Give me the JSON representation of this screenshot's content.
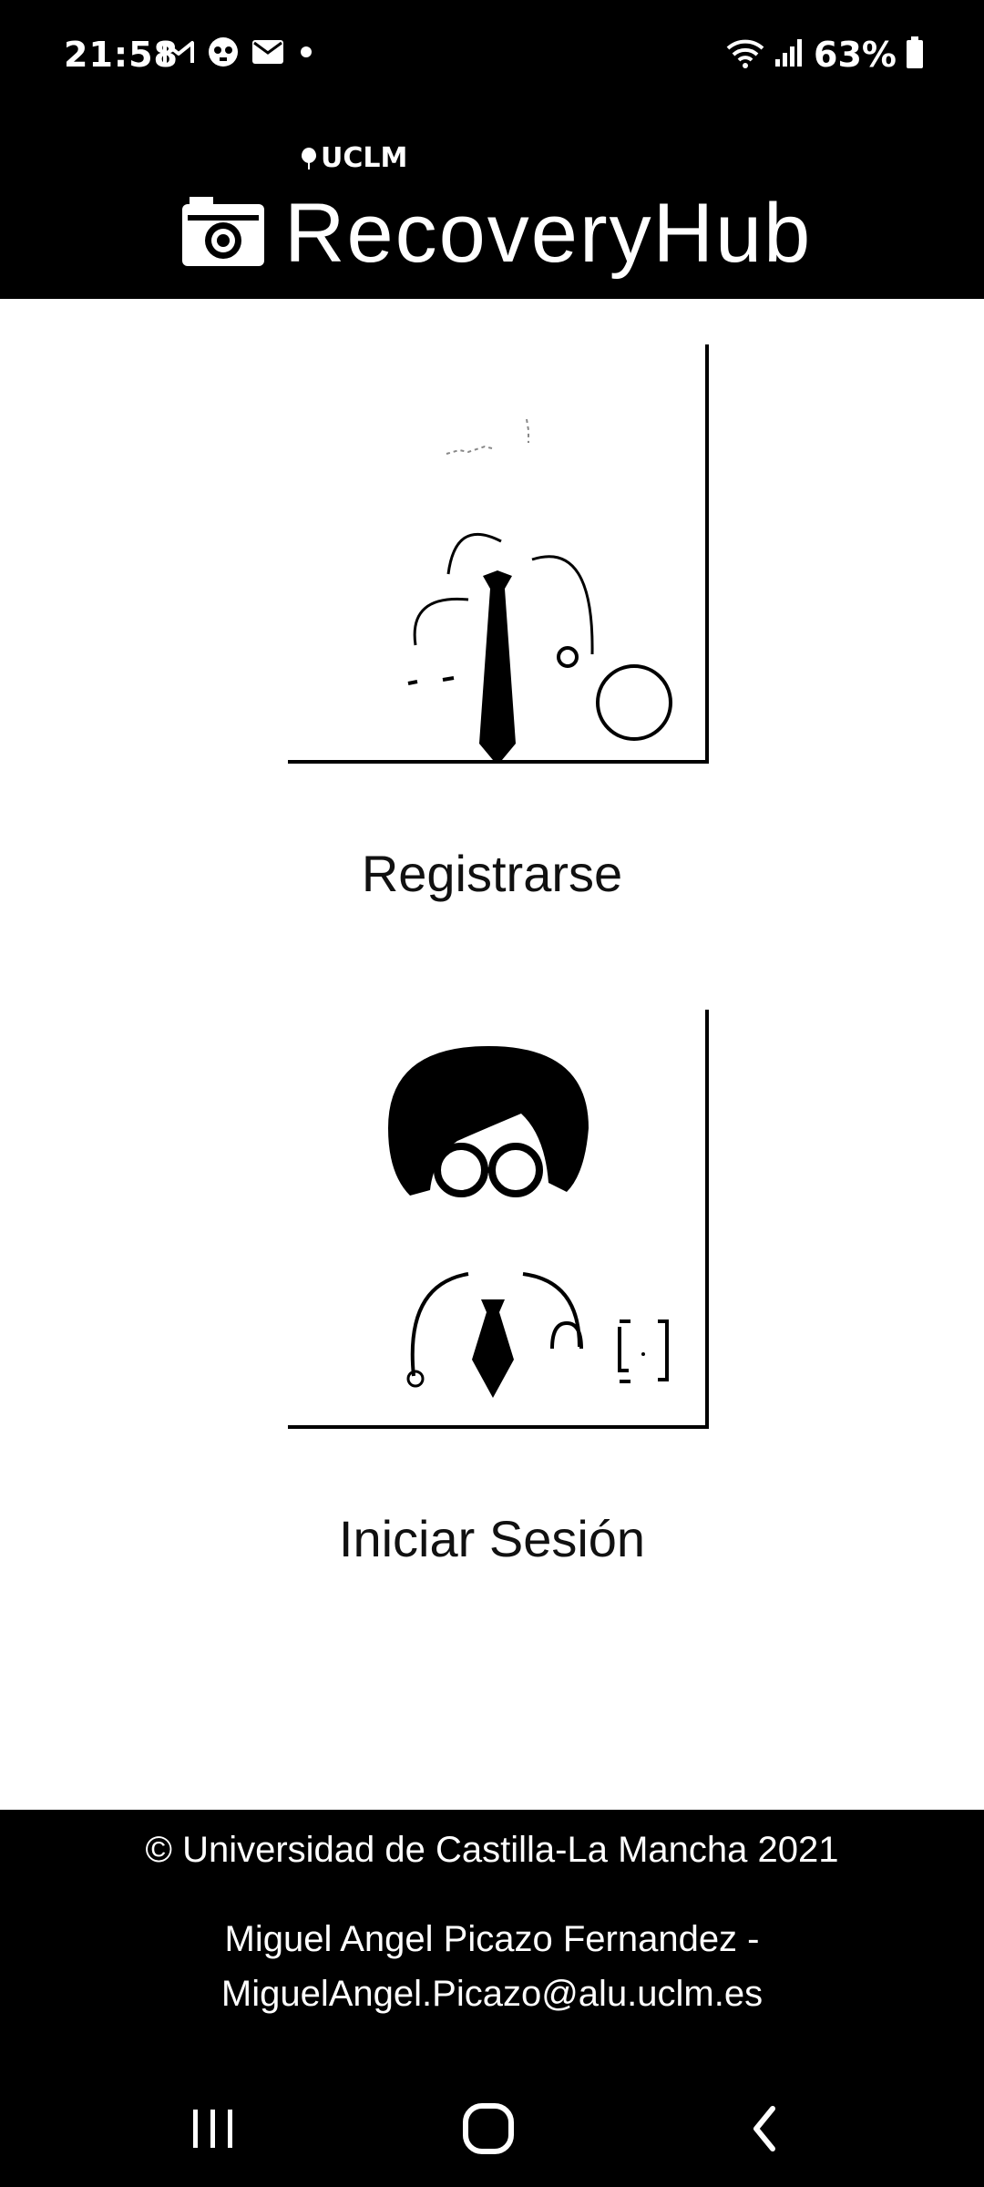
{
  "status_bar": {
    "time": "21:58",
    "left_icons": [
      "gmail-icon",
      "skull-icon",
      "mail-icon",
      "dot-icon"
    ],
    "right_icons": [
      "wifi-icon",
      "signal-icon",
      "battery-icon"
    ],
    "battery": "63%"
  },
  "header": {
    "org_logo": "UCLM",
    "app_name": "RecoveryHub",
    "logo_icon": "camera-icon"
  },
  "actions": {
    "register_label": "Registrarse",
    "register_icon": "doctor-outline-icon",
    "login_label": "Iniciar Sesión",
    "login_icon": "doctor-filled-icon"
  },
  "footer": {
    "copyright": "© Universidad de Castilla-La Mancha 2021",
    "author_line1": "Miguel Angel Picazo Fernandez -",
    "author_line2": "MiguelAngel.Picazo@alu.uclm.es"
  },
  "nav": {
    "icons": [
      "recent-apps-icon",
      "home-icon",
      "back-icon"
    ]
  },
  "colors": {
    "bar_background": "#000000",
    "page_background": "#ffffff",
    "text_light": "#ffffff",
    "text_dark": "#111111"
  }
}
